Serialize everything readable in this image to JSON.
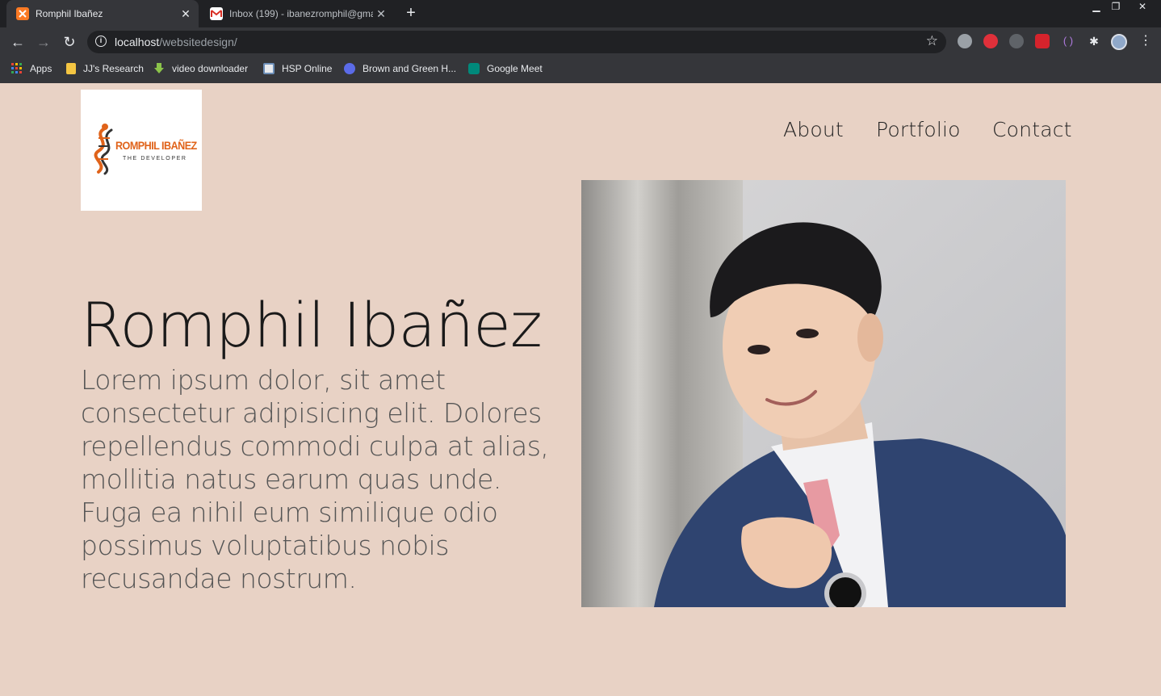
{
  "browser": {
    "tabs": [
      {
        "title": "Romphil Ibañez",
        "favicon": "xampp-icon",
        "active": true
      },
      {
        "title": "Inbox (199) - ibanezromphil@gmail.com",
        "favicon": "gmail-icon",
        "active": false
      }
    ],
    "new_tab_label": "+",
    "url_host": "localhost",
    "url_path": "/websitedesign/",
    "bookmarks": [
      {
        "label": "Apps",
        "icon": "apps-grid-icon"
      },
      {
        "label": "JJ's Research",
        "icon": "folder-icon"
      },
      {
        "label": "video downloader",
        "icon": "download-arrow-icon"
      },
      {
        "label": "HSP Online",
        "icon": "hsp-icon"
      },
      {
        "label": "Brown and Green H...",
        "icon": "canva-icon"
      },
      {
        "label": "Google Meet",
        "icon": "google-meet-icon"
      }
    ]
  },
  "site": {
    "logo": {
      "name": "ROMPHIL IBAÑEZ",
      "tagline": "THE DEVELOPER"
    },
    "nav": [
      "About",
      "Portfolio",
      "Contact"
    ],
    "hero": {
      "name": "Romphil Ibañez",
      "text": "Lorem ipsum dolor, sit amet consectetur adipisicing elit. Dolores repellendus commodi culpa at alias, mollitia natus earum quas unde. Fuga ea nihil eum similique odio possimus voluptatibus nobis recusandae nostrum."
    }
  },
  "colors": {
    "page_bg": "#e8d2c5",
    "logo_orange": "#e0631a",
    "chrome_dark": "#202124",
    "chrome_toolbar": "#35363a"
  }
}
